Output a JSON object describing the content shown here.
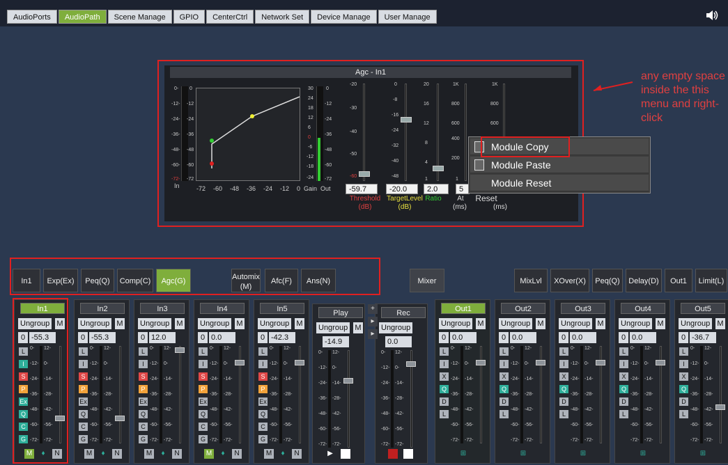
{
  "tabs": [
    "AudioPorts",
    "AudioPath",
    "Scene Manage",
    "GPIO",
    "CenterCtrl",
    "Network Set",
    "Device Manage",
    "User Manage"
  ],
  "agc": {
    "title": "Agc - In1",
    "graph_y_ticks": [
      "0-",
      "-12-",
      "-24-",
      "-36-",
      "-48-",
      "-60-",
      "-72-"
    ],
    "graph_y_ticks2": [
      "0",
      "-12",
      "-24",
      "-36",
      "-48",
      "-60",
      "-72"
    ],
    "graph_x_ticks": [
      "-72",
      "-60",
      "-48",
      "-36",
      "-24",
      "-12",
      "0"
    ],
    "in_label": "In",
    "gain_ticks": [
      "30",
      "24",
      "18",
      "12",
      "6",
      "0",
      "-6",
      "-12",
      "-18",
      "-24"
    ],
    "out_ticks": [
      "0",
      "-12",
      "-24",
      "-36",
      "-48",
      "-60",
      "-72"
    ],
    "gain_label": "Gain",
    "out_label": "Out",
    "threshold": {
      "value": "-59.7",
      "label": "Threshold",
      "unit": "(dB)",
      "ticks": [
        "-20",
        "-30",
        "-40",
        "-50",
        "-60"
      ]
    },
    "target": {
      "value": "-20.0",
      "label": "TargetLevel",
      "unit": "(dB)",
      "ticks": [
        "0",
        "-8",
        "-16",
        "-24",
        "-32",
        "-40",
        "-48"
      ]
    },
    "ratio": {
      "value": "2.0",
      "label": "Ratio",
      "ticks": [
        "20",
        "16",
        "12",
        "8",
        "4",
        "1"
      ]
    },
    "attack": {
      "value": "5",
      "label": "At",
      "unit": "(ms)",
      "ticks": [
        "1K",
        "800",
        "600",
        "400",
        "200",
        "1"
      ]
    },
    "release": {
      "label": "Reset",
      "unit": "(ms)",
      "ticks": [
        "1K",
        "800",
        "600",
        "400",
        "200"
      ]
    }
  },
  "context_menu": [
    "Module Copy",
    "Module Paste",
    "Module Reset"
  ],
  "annotation": "any empty space inside the this menu and right-click",
  "modules": [
    "In1",
    "Exp(Ex)",
    "Peq(Q)",
    "Comp(C)",
    "Agc(G)",
    "Automix (M)",
    "Afc(F)",
    "Ans(N)",
    "Mixer",
    "MixLvl",
    "XOver(X)",
    "Peq(Q)",
    "Delay(D)",
    "Out1",
    "Limit(L)"
  ],
  "ungroup": "Ungroup",
  "m_label": "M",
  "zero_label": "0",
  "channels": [
    {
      "name": "In1",
      "value": "-55.3"
    },
    {
      "name": "In2",
      "value": "-55.3"
    },
    {
      "name": "In3",
      "value": "12.0"
    },
    {
      "name": "In4",
      "value": "0.0"
    },
    {
      "name": "In5",
      "value": "-42.3"
    },
    {
      "name": "Play",
      "value": "-14.9"
    },
    {
      "name": "Rec",
      "value": "0.0"
    },
    {
      "name": "Out1",
      "value": "0.0"
    },
    {
      "name": "Out2",
      "value": "0.0"
    },
    {
      "name": "Out3",
      "value": "0.0"
    },
    {
      "name": "Out4",
      "value": "0.0"
    },
    {
      "name": "Out5",
      "value": "-36.7"
    }
  ],
  "in_side": [
    "L",
    "I",
    "S",
    "P",
    "Ex",
    "Q",
    "C",
    "G"
  ],
  "out_side": [
    "L",
    "I",
    "X",
    "Q",
    "D",
    "L"
  ],
  "scale_left": [
    "0-",
    "-12-",
    "-24-",
    "-36-",
    "-48-",
    "-60-",
    "-72-"
  ],
  "scale_right": [
    "12-",
    "0-",
    "-14-",
    "-28-",
    "-42-",
    "-56-",
    "-72-"
  ],
  "bottom_in": [
    "M",
    "N"
  ]
}
